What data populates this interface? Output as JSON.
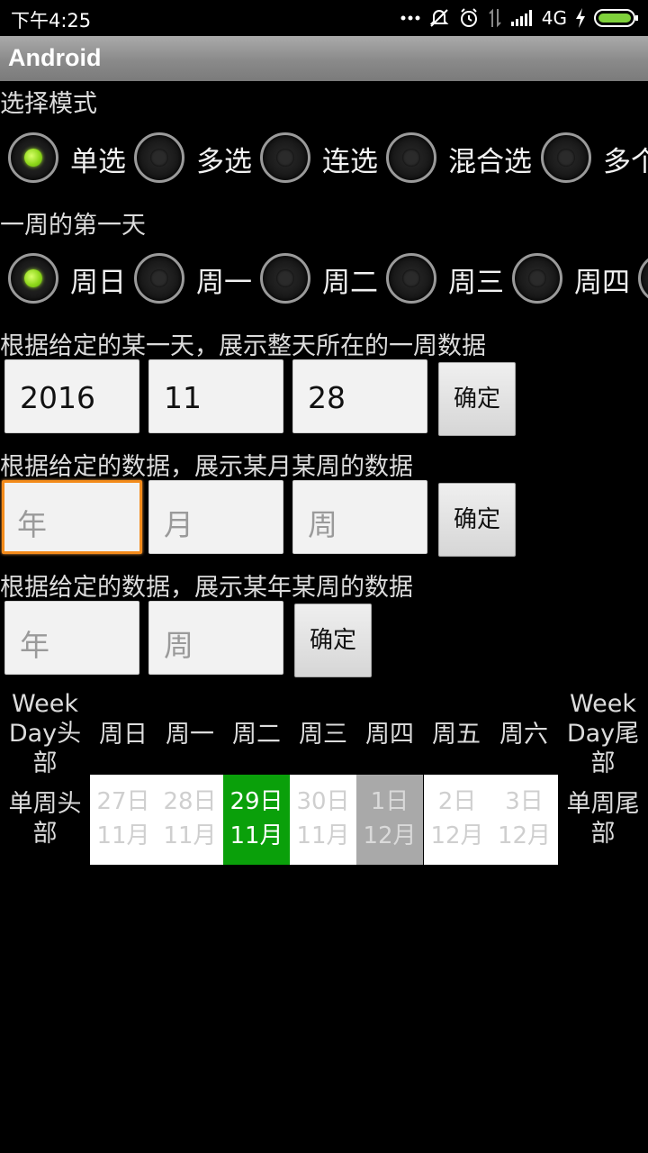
{
  "status_bar": {
    "time": "下午4:25",
    "network": "4G",
    "icons": [
      "more-dots-icon",
      "mute-icon",
      "alarm-icon",
      "data-arrows-icon",
      "signal-icon",
      "charging-icon",
      "battery-icon"
    ],
    "battery_color": "#7fd13b"
  },
  "app_title": "Android",
  "selection_mode": {
    "label": "选择模式",
    "options": [
      "单选",
      "多选",
      "连选",
      "混合选",
      "多个"
    ],
    "selected_index": 0
  },
  "first_day": {
    "label": "一周的第一天",
    "options": [
      "周日",
      "周一",
      "周二",
      "周三",
      "周四"
    ],
    "selected_index": 0
  },
  "section_by_day": {
    "label": "根据给定的某一天，展示整天所在的一周数据",
    "year": "2016",
    "month": "11",
    "day": "28",
    "confirm": "确定"
  },
  "section_by_month_week": {
    "label": "根据给定的数据，展示某月某周的数据",
    "year_placeholder": "年",
    "month_placeholder": "月",
    "week_placeholder": "周",
    "confirm": "确定"
  },
  "section_by_year_week": {
    "label": "根据给定的数据，展示某年某周的数据",
    "year_placeholder": "年",
    "week_placeholder": "周",
    "confirm": "确定"
  },
  "week_view": {
    "header_left": "Week Day头部",
    "header_right": "Week Day尾部",
    "weekdays": [
      "周日",
      "周一",
      "周二",
      "周三",
      "周四",
      "周五",
      "周六"
    ],
    "row_left": "单周头部",
    "row_right": "单周尾部",
    "days": [
      {
        "day": "27日",
        "month": "11月",
        "state": "normal"
      },
      {
        "day": "28日",
        "month": "11月",
        "state": "normal"
      },
      {
        "day": "29日",
        "month": "11月",
        "state": "selected"
      },
      {
        "day": "30日",
        "month": "11月",
        "state": "normal"
      },
      {
        "day": "1日",
        "month": "12月",
        "state": "grey"
      },
      {
        "day": "2日",
        "month": "12月",
        "state": "normal"
      },
      {
        "day": "3日",
        "month": "12月",
        "state": "normal"
      }
    ],
    "selected_color": "#0aa00a"
  }
}
